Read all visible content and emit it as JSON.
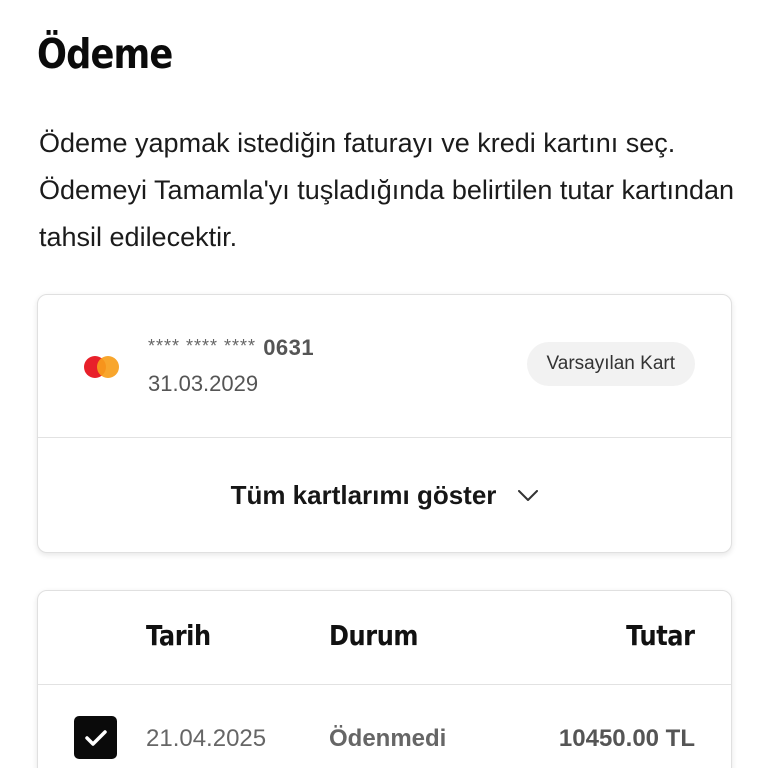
{
  "page": {
    "title": "Ödeme",
    "description": "Ödeme yapmak istediğin faturayı ve kredi kartını seç. Ödemeyi Tamamla'yı tuşladığında belirtilen tutar kartından tahsil edilecektir."
  },
  "payment_card": {
    "brand_icon": "mastercard-logo",
    "mask": "**** **** ****",
    "last4": "0631",
    "expiry": "31.03.2029",
    "badge": "Varsayılan Kart",
    "show_all_label": "Tüm kartlarımı göster",
    "show_all_icon": "chevron-down-icon"
  },
  "bills": {
    "columns": {
      "date": "Tarih",
      "status": "Durum",
      "amount": "Tutar"
    },
    "rows": [
      {
        "checked": true,
        "date": "21.04.2025",
        "status": "Ödenmedi",
        "amount": "10450.00 TL"
      }
    ]
  },
  "colors": {
    "mastercard_red": "#e8202a",
    "mastercard_orange": "#f79e1b",
    "checkbox_fill": "#0a0a0a"
  }
}
